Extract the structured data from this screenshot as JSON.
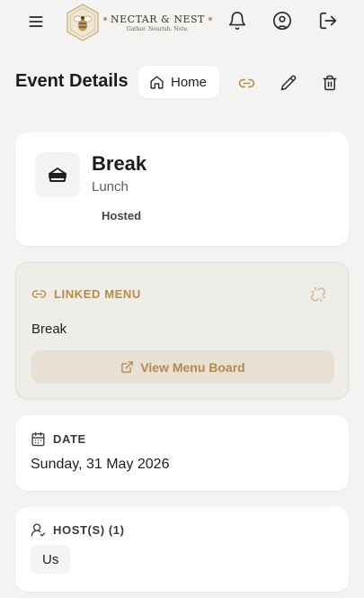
{
  "brand": {
    "name": "NECTAR & NEST",
    "tagline": "Gather. Nourish. Note."
  },
  "header": {
    "title": "Event Details",
    "home_label": "Home"
  },
  "event": {
    "title": "Break",
    "subtitle": "Lunch",
    "badge": "Hosted"
  },
  "linked_menu": {
    "label": "LINKED MENU",
    "name": "Break",
    "button_label": "View Menu Board"
  },
  "date": {
    "label": "DATE",
    "value": "Sunday, 31 May 2026"
  },
  "hosts": {
    "label": "HOST(S) (1)",
    "items": [
      "Us"
    ]
  },
  "colors": {
    "accent": "#b38c4e",
    "background": "#f3f3f2",
    "card": "#ffffff",
    "linked_card_bg": "#efede8",
    "button_bg": "#e8e0d2"
  },
  "icons": [
    "menu-icon",
    "brand-logo",
    "bell-icon",
    "user-circle-icon",
    "logout-icon",
    "home-icon",
    "link-icon",
    "pencil-icon",
    "trash-icon",
    "sandwich-icon",
    "unlink-icon",
    "external-link-icon",
    "calendar-icon",
    "user-check-icon"
  ]
}
